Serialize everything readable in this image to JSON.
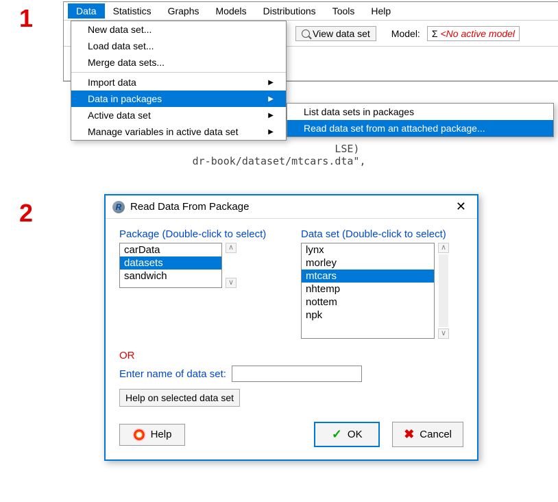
{
  "steps": {
    "s1": "1",
    "s2": "2"
  },
  "menubar": [
    "Data",
    "Statistics",
    "Graphs",
    "Models",
    "Distributions",
    "Tools",
    "Help"
  ],
  "menubar_active_index": 0,
  "toolbar": {
    "view_data_set": "View data set",
    "model_label": "Model:",
    "model_value": "<No active model",
    "sigma": "Σ"
  },
  "code_bg": {
    "line1": "LSE)",
    "line2": "dr-book/dataset/mtcars.dta\","
  },
  "data_menu": {
    "items": [
      {
        "label": "New data set...",
        "sub": false
      },
      {
        "label": "Load data set...",
        "sub": false
      },
      {
        "label": "Merge data sets...",
        "sub": false
      },
      {
        "sep": true
      },
      {
        "label": "Import data",
        "sub": true
      },
      {
        "label": "Data in packages",
        "sub": true,
        "hl": true
      },
      {
        "label": "Active data set",
        "sub": true
      },
      {
        "label": "Manage variables in active data set",
        "sub": true
      }
    ]
  },
  "submenu": {
    "items": [
      {
        "label": "List data sets in packages"
      },
      {
        "label": "Read data set from an attached package...",
        "hl": true
      }
    ]
  },
  "dialog": {
    "title": "Read Data From Package",
    "package_label": "Package (Double-click to select)",
    "dataset_label": "Data set (Double-click to select)",
    "packages": [
      "carData",
      "datasets",
      "sandwich"
    ],
    "packages_selected": "datasets",
    "datasets": [
      "lynx",
      "morley",
      "mtcars",
      "nhtemp",
      "nottem",
      "npk"
    ],
    "datasets_selected": "mtcars",
    "or": "OR",
    "enter_label": "Enter name of data set:",
    "enter_value": "",
    "help_selected": "Help on selected data set",
    "help_btn": "Help",
    "ok_btn": "OK",
    "cancel_btn": "Cancel"
  }
}
